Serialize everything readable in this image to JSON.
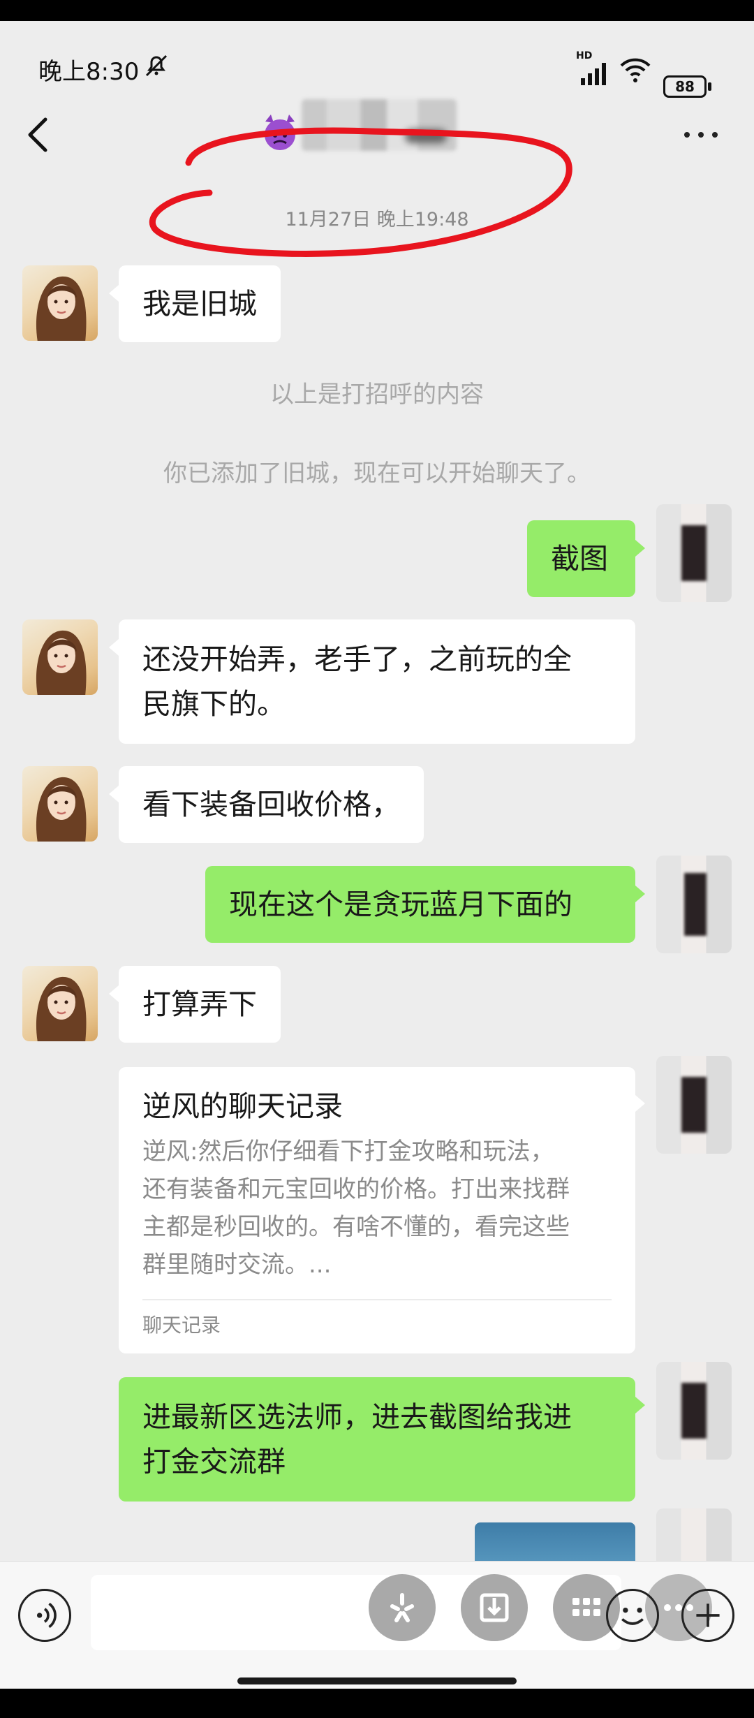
{
  "status_bar": {
    "time": "晚上8:30",
    "hd": "HD",
    "battery": "88"
  },
  "header": {
    "contact_name_obscured": ""
  },
  "timestamp": "11月27日 晚上19:48",
  "system_messages": {
    "greeting_note": "以上是打招呼的内容",
    "added_note": "你已添加了旧城，现在可以开始聊天了。"
  },
  "messages": [
    {
      "side": "in",
      "text": "我是旧城"
    },
    {
      "side": "out",
      "text": "截图"
    },
    {
      "side": "in",
      "line1": "还没开始弄，老手了，之前玩的全",
      "line2": "民旗下的。"
    },
    {
      "side": "in",
      "text": "看下装备回收价格，"
    },
    {
      "side": "out",
      "text": "现在这个是贪玩蓝月下面的"
    },
    {
      "side": "in",
      "text": "打算弄下"
    },
    {
      "side": "out",
      "line1": "进最新区选法师，进去截图给我进",
      "line2": "打金交流群"
    }
  ],
  "chat_record_card": {
    "title": "逆风的聊天记录",
    "line1": "逆风:然后你仔细看下打金攻略和玩法，",
    "line2": "还有装备和元宝回收的价格。打出来找群",
    "line3": "主都是秒回收的。有啥不懂的，看完这些",
    "line4": "群里随时交流。...",
    "footer": "聊天记录"
  },
  "colors": {
    "background": "#ededed",
    "outgoing_bubble": "#95ec69",
    "incoming_bubble": "#ffffff",
    "annotation": "#e8141e"
  },
  "icons": [
    "mute-icon",
    "signal-icon",
    "wifi-icon",
    "battery-icon",
    "back-icon",
    "devil-emoji-icon",
    "more-icon",
    "voice-icon",
    "emoji-icon",
    "plus-icon"
  ]
}
